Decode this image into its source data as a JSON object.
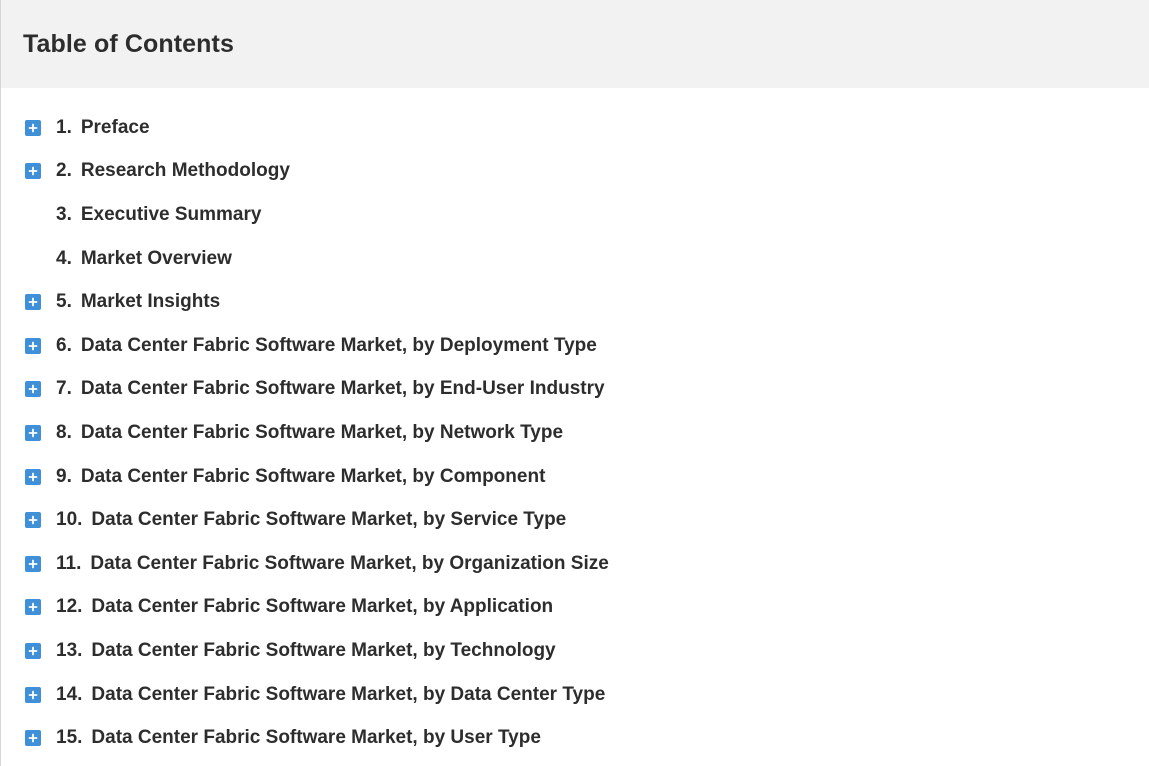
{
  "toc": {
    "title": "Table of Contents",
    "items": [
      {
        "number": "1.",
        "label": "Preface",
        "expandable": true
      },
      {
        "number": "2.",
        "label": "Research Methodology",
        "expandable": true
      },
      {
        "number": "3.",
        "label": "Executive Summary",
        "expandable": false
      },
      {
        "number": "4.",
        "label": "Market Overview",
        "expandable": false
      },
      {
        "number": "5.",
        "label": "Market Insights",
        "expandable": true
      },
      {
        "number": "6.",
        "label": "Data Center Fabric Software Market, by Deployment Type",
        "expandable": true
      },
      {
        "number": "7.",
        "label": "Data Center Fabric Software Market, by End-User Industry",
        "expandable": true
      },
      {
        "number": "8.",
        "label": "Data Center Fabric Software Market, by Network Type",
        "expandable": true
      },
      {
        "number": "9.",
        "label": "Data Center Fabric Software Market, by Component",
        "expandable": true
      },
      {
        "number": "10.",
        "label": "Data Center Fabric Software Market, by Service Type",
        "expandable": true
      },
      {
        "number": "11.",
        "label": "Data Center Fabric Software Market, by Organization Size",
        "expandable": true
      },
      {
        "number": "12.",
        "label": "Data Center Fabric Software Market, by Application",
        "expandable": true
      },
      {
        "number": "13.",
        "label": "Data Center Fabric Software Market, by Technology",
        "expandable": true
      },
      {
        "number": "14.",
        "label": "Data Center Fabric Software Market, by Data Center Type",
        "expandable": true
      },
      {
        "number": "15.",
        "label": "Data Center Fabric Software Market, by User Type",
        "expandable": true
      }
    ]
  },
  "icons": {
    "expand": "plus-icon"
  },
  "colors": {
    "expand_button": "#3f8fd9",
    "header_background": "#f2f2f2"
  }
}
